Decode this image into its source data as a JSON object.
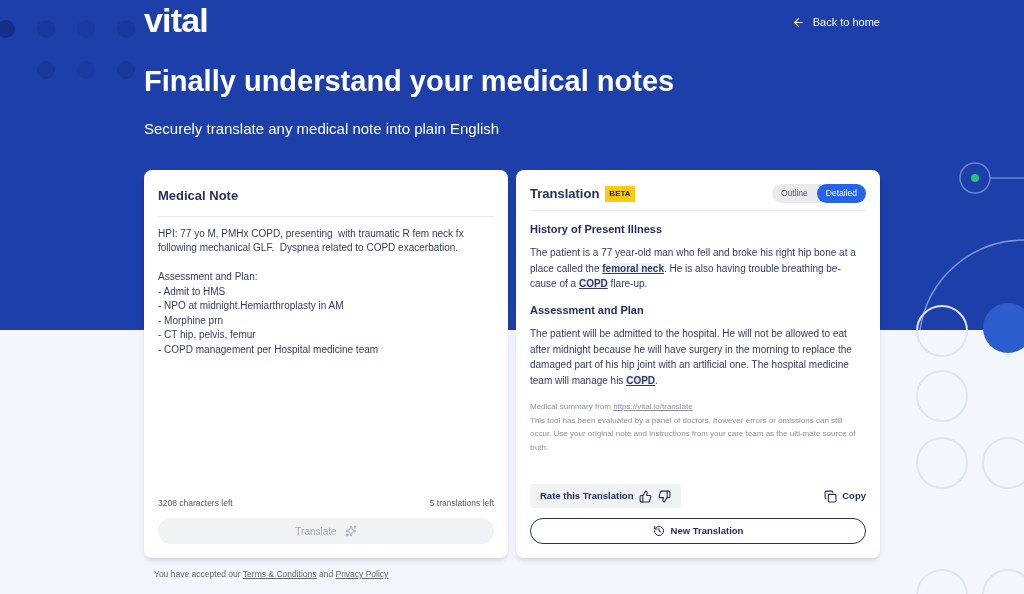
{
  "header": {
    "logo": "vital",
    "back_link": "Back to home",
    "title": "Finally understand your medical notes",
    "subtitle": "Securely translate any medical note into plain English"
  },
  "note_card": {
    "title": "Medical Note",
    "value": "HPI: 77 yo M, PMHx COPD, presenting  with traumatic R fem neck fx\nfollowing mechanical GLF.  Dyspnea related to COPD exacerbation.\n\nAssessment and Plan:\n- Admit to HMS\n- NPO at midnight.Hemiarthroplasty in AM\n- Morphine prn\n- CT hip, pelvis, femur\n- COPD management per Hospital medicine team",
    "chars_left": "3208 characters left",
    "translations_left": "5 translations left",
    "translate_button": {
      "label": "Translate",
      "disabled": true
    }
  },
  "translation_card": {
    "title": "Translation",
    "badge": "BETA",
    "view_toggle": [
      {
        "label": "Outline",
        "selected": false
      },
      {
        "label": "Detailed",
        "selected": true
      }
    ],
    "sections": [
      {
        "heading": "History of Present Illness",
        "parts": [
          {
            "kind": "text",
            "text": "The patient is a 77 year-old man who fell and broke his right hip bone at a place called the "
          },
          {
            "kind": "term",
            "text": "femoral neck"
          },
          {
            "kind": "text",
            "text": ". He is also having trouble breathing be-cause of a "
          },
          {
            "kind": "term",
            "text": "COPD"
          },
          {
            "kind": "text",
            "text": " flare-up."
          }
        ]
      },
      {
        "heading": "Assessment and Plan",
        "parts": [
          {
            "kind": "text",
            "text": "The patient will be admitted to the hospital. He will not be allowed to eat after midnight because he will have surgery in the morning to replace the damaged part of his hip joint with an artificial one. The hospital medicine team will manage his "
          },
          {
            "kind": "term",
            "text": "COPD"
          },
          {
            "kind": "text",
            "text": "."
          }
        ]
      }
    ],
    "source_prefix": "Medical summary from ",
    "source_link": "https://vital.io/translate",
    "disclaimer": "This tool has been evaluated by a panel of doctors, however errors or omissions can still occur. Use your original note and instructions from your care team as the ulti-mate source of truth.",
    "rate_label": "Rate this Translation",
    "copy_button": "Copy",
    "new_button": "New Translation"
  },
  "footer": {
    "parts": [
      {
        "kind": "text",
        "text": "You have accepted our "
      },
      {
        "kind": "link",
        "text": "Terms & Conditions"
      },
      {
        "kind": "text",
        "text": " and "
      },
      {
        "kind": "link",
        "text": "Privacy Policy"
      }
    ]
  }
}
